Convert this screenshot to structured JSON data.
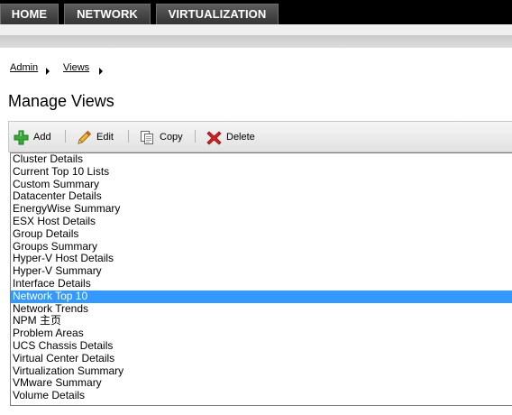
{
  "nav": {
    "tabs": [
      {
        "label": "HOME"
      },
      {
        "label": "NETWORK"
      },
      {
        "label": "VIRTUALIZATION"
      }
    ]
  },
  "breadcrumb": {
    "items": [
      {
        "label": "Admin"
      },
      {
        "label": "Views"
      }
    ]
  },
  "page": {
    "title": "Manage Views"
  },
  "toolbar": {
    "add_label": "Add",
    "edit_label": "Edit",
    "copy_label": "Copy",
    "delete_label": "Delete",
    "icons": {
      "add": "plus-icon",
      "edit": "pencil-icon",
      "copy": "copy-icon",
      "delete": "delete-x-icon"
    }
  },
  "views_list": {
    "selected_index": 11,
    "items": [
      "Cluster Details",
      "Current Top 10 Lists",
      "Custom Summary",
      "Datacenter Details",
      "EnergyWise Summary",
      "ESX Host Details",
      "Group Details",
      "Groups Summary",
      "Hyper-V Host Details",
      "Hyper-V Summary",
      "Interface Details",
      "Network Top 10",
      "Network Trends",
      "NPM 主页",
      "Problem Areas",
      "UCS Chassis Details",
      "Virtual Center Details",
      "Virtualization Summary",
      "VMware Summary",
      "Volume Details"
    ]
  },
  "colors": {
    "nav_bg": "#000000",
    "tab_bg": "#444444",
    "selection": "#3399ff",
    "delete_icon": "#d42020",
    "add_icon": "#3aa83a",
    "edit_icon": "#e8a21a"
  }
}
